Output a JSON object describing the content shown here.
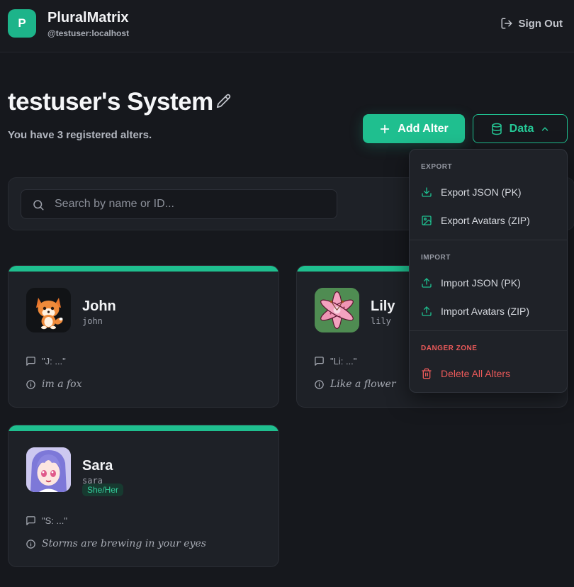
{
  "app": {
    "logo_letter": "P",
    "title": "PluralMatrix",
    "user": "@testuser:localhost",
    "sign_out": "Sign Out"
  },
  "system": {
    "title": "testuser's System",
    "subtitle": "You have 3 registered alters."
  },
  "actions": {
    "add_alter": "Add Alter",
    "data": "Data"
  },
  "search": {
    "placeholder": "Search by name or ID..."
  },
  "alters": [
    {
      "name": "John",
      "handle": "john",
      "message": "\"J: ...\"",
      "description": "im a fox",
      "avatar": "fox-icon"
    },
    {
      "name": "Lily",
      "handle": "lily",
      "message": "\"Li: ...\"",
      "description": "Like a flower",
      "avatar": "lily-flower-icon"
    },
    {
      "name": "Sara",
      "handle": "sara",
      "pronouns": "She/Her",
      "message": "\"S: ...\"",
      "description": "Storms are brewing in your eyes",
      "avatar": "anime-girl-icon"
    }
  ],
  "data_menu": {
    "export_heading": "EXPORT",
    "export_json": "Export JSON (PK)",
    "export_avatars": "Export Avatars (ZIP)",
    "import_heading": "IMPORT",
    "import_json": "Import JSON (PK)",
    "import_avatars": "Import Avatars (ZIP)",
    "danger_heading": "DANGER ZONE",
    "delete_all": "Delete All Alters"
  },
  "colors": {
    "accent": "#1fbf8f",
    "danger": "#ec5a5a",
    "background": "#16181d",
    "card": "#1e2127"
  }
}
